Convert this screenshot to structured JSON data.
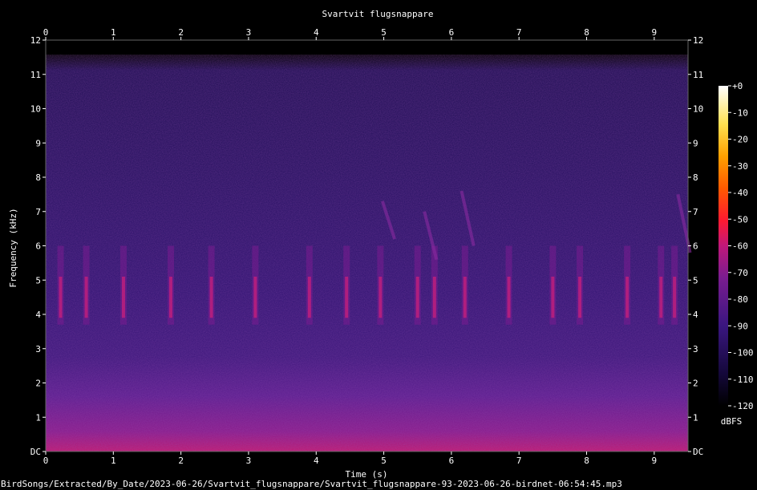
{
  "chart_data": {
    "type": "heatmap",
    "title": "Svartvit flugsnappare",
    "xlabel": "Time (s)",
    "ylabel": "Frequency (kHz)",
    "xlim": [
      0,
      9.5
    ],
    "ylim": [
      0,
      12
    ],
    "x_ticks": [
      "0",
      "1",
      "2",
      "3",
      "4",
      "5",
      "6",
      "7",
      "8",
      "9"
    ],
    "y_ticks": [
      "DC",
      "1",
      "2",
      "3",
      "4",
      "5",
      "6",
      "7",
      "8",
      "9",
      "10",
      "11",
      "12"
    ],
    "colorbar": {
      "label": "dBFS",
      "range": [
        -120,
        0
      ],
      "ticks": [
        "+0",
        "-10",
        "-20",
        "-30",
        "-40",
        "-50",
        "-60",
        "-70",
        "-80",
        "-90",
        "-100",
        "-110",
        "-120"
      ]
    },
    "colormap": [
      "#000000",
      "#1a0a40",
      "#3a1680",
      "#7a1c90",
      "#c0187a",
      "#ff1a30",
      "#ff6a00",
      "#ffb400",
      "#ffe860",
      "#ffffff"
    ]
  },
  "caption": "BirdSongs/Extracted/By_Date/2023-06-26/Svartvit_flugsnappare/Svartvit_flugsnappare-93-2023-06-26-birdnet-06:54:45.mp3"
}
